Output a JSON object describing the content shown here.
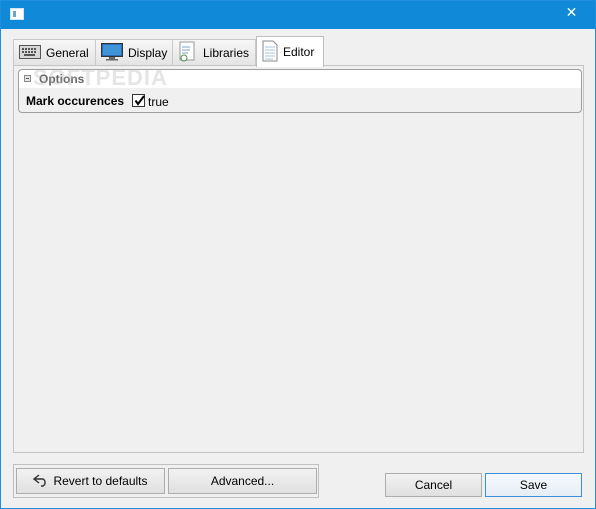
{
  "window": {
    "close_glyph": "✕"
  },
  "tabs": [
    {
      "label": "General",
      "icon": "keyboard-icon"
    },
    {
      "label": "Display",
      "icon": "monitor-icon"
    },
    {
      "label": "Libraries",
      "icon": "libraries-icon"
    },
    {
      "label": "Editor",
      "icon": "document-icon",
      "active": true
    }
  ],
  "options": {
    "title": "Options",
    "properties": [
      {
        "name": "Mark occurences",
        "checked": true,
        "value": "true"
      }
    ]
  },
  "buttons": {
    "revert": "Revert to defaults",
    "advanced": "Advanced...",
    "cancel": "Cancel",
    "save": "Save"
  },
  "watermark": "SOFTPEDIA",
  "colors": {
    "titlebar": "#0f89d8",
    "window_bg": "#f0f0f0"
  }
}
